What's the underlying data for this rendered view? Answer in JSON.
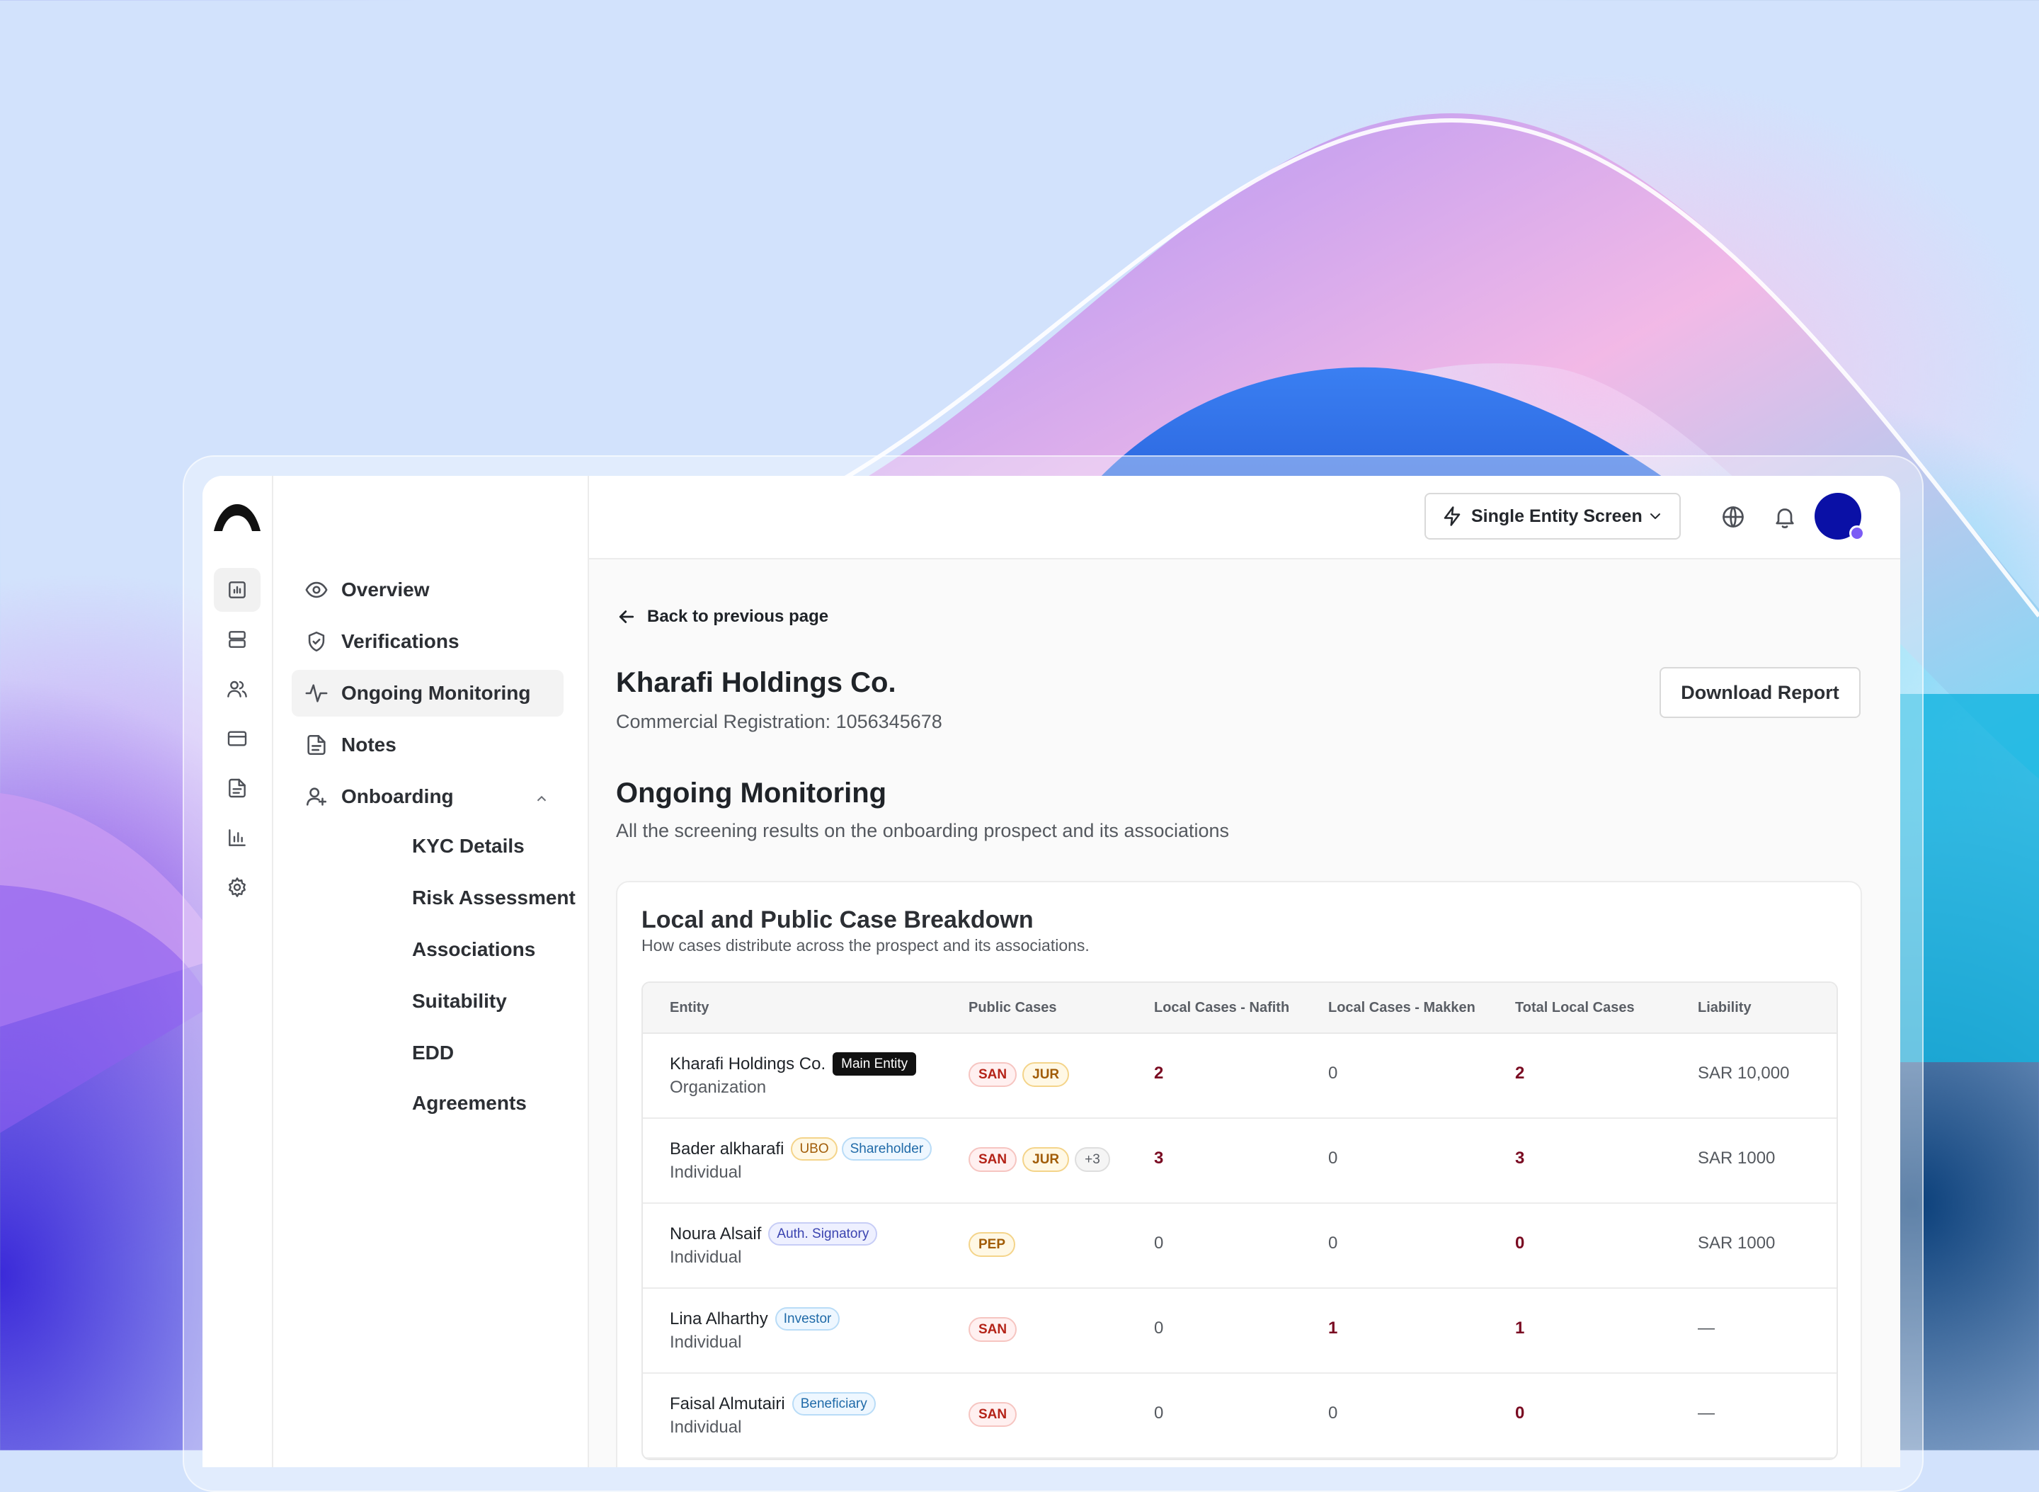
{
  "header": {
    "mode_select": "Single Entity Screen"
  },
  "nav": {
    "items": [
      {
        "label": "Overview",
        "icon": "eye-icon"
      },
      {
        "label": "Verifications",
        "icon": "shield-check-icon"
      },
      {
        "label": "Ongoing Monitoring",
        "icon": "activity-icon",
        "active": true
      },
      {
        "label": "Notes",
        "icon": "file-text-icon"
      },
      {
        "label": "Onboarding",
        "icon": "user-plus-icon",
        "expanded": true
      }
    ],
    "onboarding_sub": [
      "KYC Details",
      "Risk Assessment",
      "Associations",
      "Suitability",
      "EDD",
      "Agreements"
    ]
  },
  "page": {
    "back_label": "Back to previous page",
    "entity_name": "Kharafi Holdings Co.",
    "entity_registration": "Commercial Registration: 1056345678",
    "download_label": "Download Report",
    "section_title": "Ongoing Monitoring",
    "section_subtitle": "All the screening results on the onboarding prospect and its associations"
  },
  "breakdown": {
    "title": "Local and Public Case Breakdown",
    "subtitle": "How cases distribute across the prospect and its associations.",
    "columns": [
      "Entity",
      "Public  Cases",
      "Local Cases - Nafith",
      "Local Cases - Makken",
      "Total Local Cases",
      "Liability"
    ],
    "rows": [
      {
        "name": "Kharafi Holdings Co.",
        "roles": [
          "Main Entity"
        ],
        "type": "Organization",
        "tags": [
          "SAN",
          "JUR"
        ],
        "nafith": "2",
        "makken": "0",
        "total": "2",
        "liability": "SAR 10,000"
      },
      {
        "name": "Bader alkharafi",
        "roles": [
          "UBO",
          "Shareholder"
        ],
        "type": "Individual",
        "tags": [
          "SAN",
          "JUR",
          "+3"
        ],
        "nafith": "3",
        "makken": "0",
        "total": "3",
        "liability": "SAR 1000"
      },
      {
        "name": "Noura Alsaif",
        "roles": [
          "Auth. Signatory"
        ],
        "type": "Individual",
        "tags": [
          "PEP"
        ],
        "nafith": "0",
        "makken": "0",
        "total": "0",
        "liability": "SAR 1000"
      },
      {
        "name": "Lina Alharthy",
        "roles": [
          "Investor"
        ],
        "type": "Individual",
        "tags": [
          "SAN"
        ],
        "nafith": "0",
        "makken": "1",
        "total": "1",
        "liability": "—"
      },
      {
        "name": "Faisal Almutairi",
        "roles": [
          "Beneficiary"
        ],
        "type": "Individual",
        "tags": [
          "SAN"
        ],
        "nafith": "0",
        "makken": "0",
        "total": "0",
        "liability": "—"
      }
    ]
  },
  "colors": {
    "accent_dark_red": "#7a0b22",
    "avatar": "#0a10a6"
  }
}
